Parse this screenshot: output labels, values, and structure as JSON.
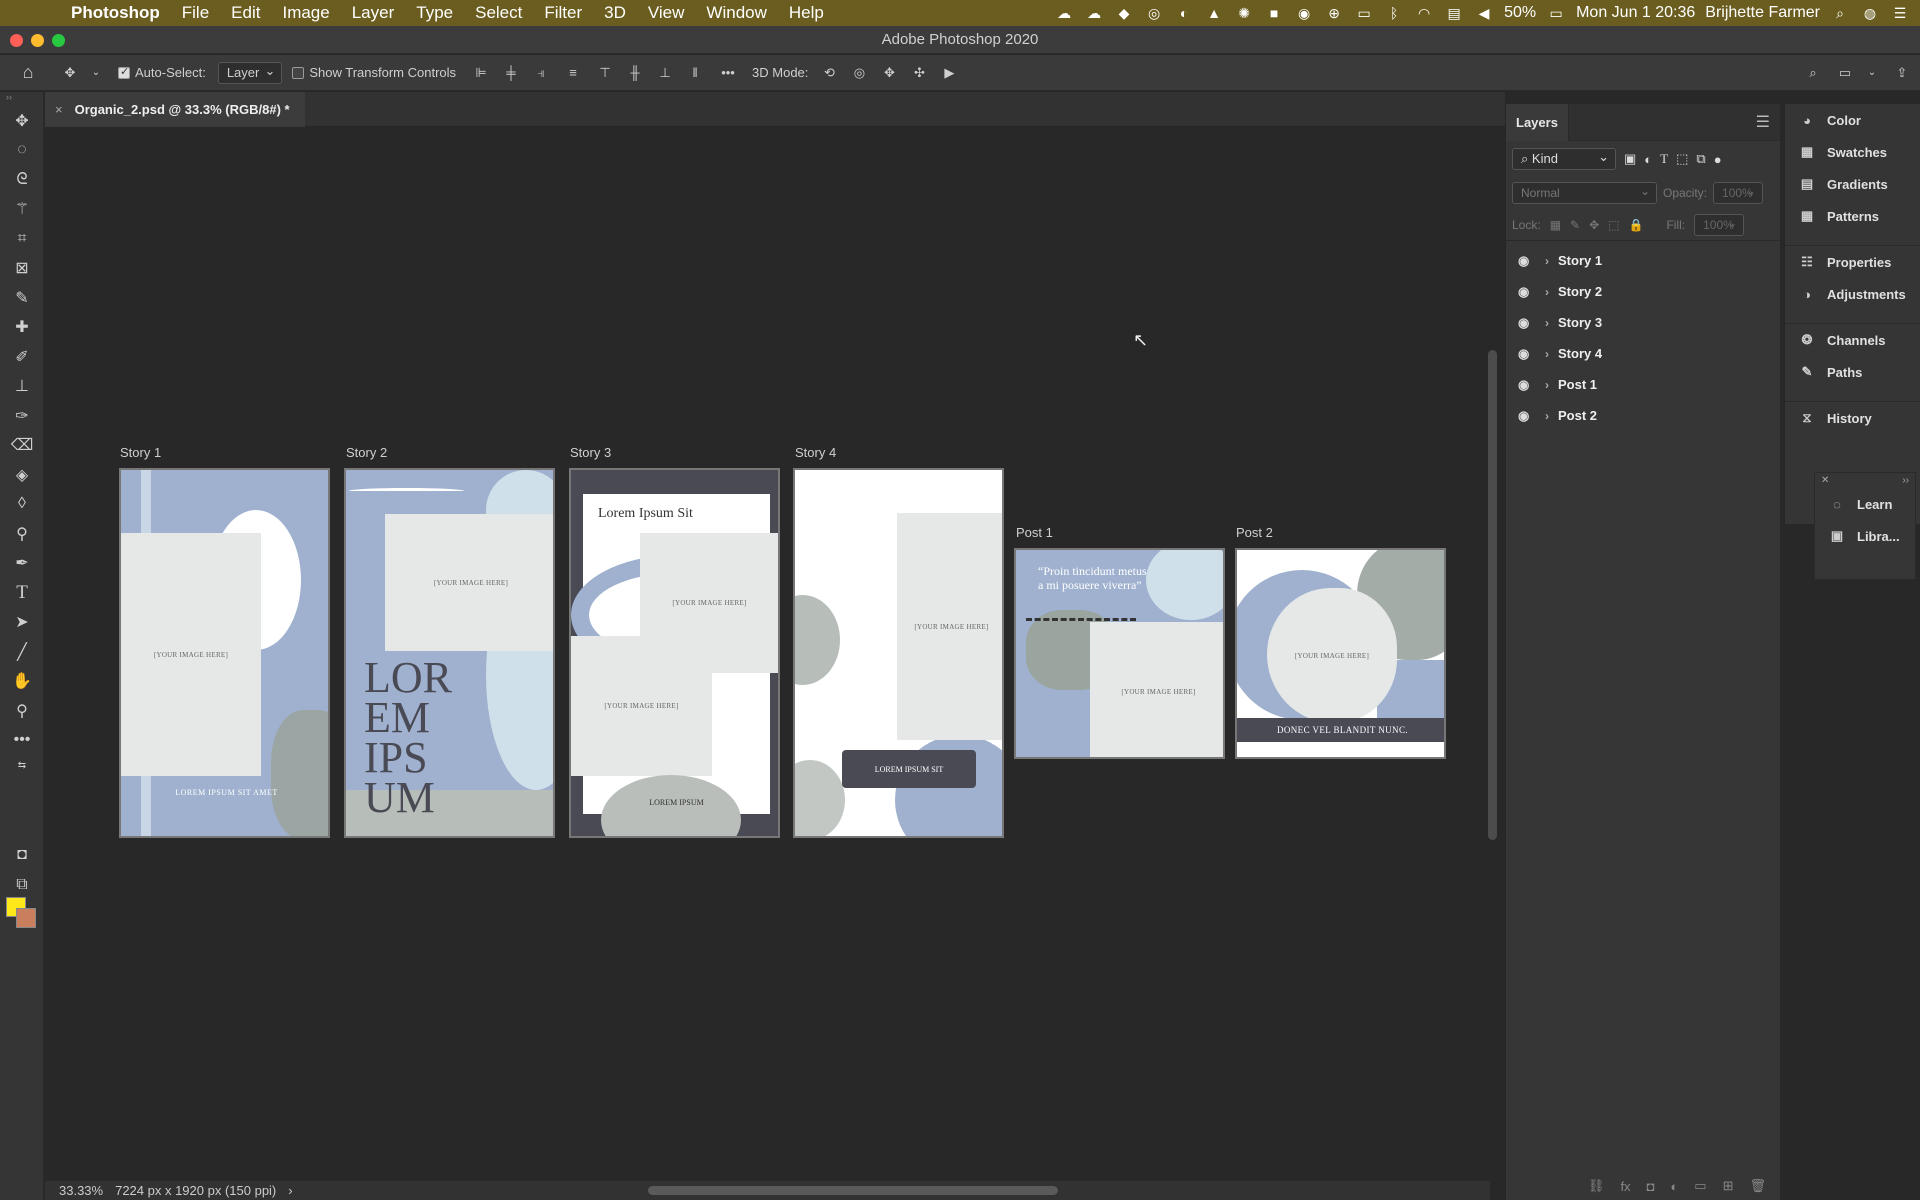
{
  "menubar": {
    "app": "Photoshop",
    "items": [
      "File",
      "Edit",
      "Image",
      "Layer",
      "Type",
      "Select",
      "Filter",
      "3D",
      "View",
      "Window",
      "Help"
    ],
    "battery": "50%",
    "datetime": "Mon Jun 1  20:36",
    "user": "Brijhette Farmer"
  },
  "window": {
    "title": "Adobe Photoshop 2020"
  },
  "options": {
    "auto_select_label": "Auto-Select:",
    "auto_select_value": "Layer",
    "show_transform_label": "Show Transform Controls",
    "mode3d_label": "3D Mode:"
  },
  "document": {
    "tab_title": "Organic_2.psd @ 33.3% (RGB/8#) *",
    "zoom": "33.33%",
    "size_info": "7224 px x 1920 px (150 ppi)"
  },
  "artboards": {
    "story1": {
      "label": "Story 1",
      "ph": "[YOUR IMAGE HERE]",
      "caption": "LOREM IPSUM SIT AMET"
    },
    "story2": {
      "label": "Story 2",
      "ph": "[YOUR IMAGE HERE]",
      "big1": "LOR",
      "big2": "EM",
      "big3": "IPS",
      "big4": "UM"
    },
    "story3": {
      "label": "Story 3",
      "title": "Lorem Ipsum Sit",
      "ph1": "[YOUR IMAGE HERE]",
      "ph2": "[YOUR IMAGE HERE]",
      "caption": "LOREM IPSUM"
    },
    "story4": {
      "label": "Story 4",
      "ph": "[YOUR IMAGE HERE]",
      "caption": "LOREM IPSUM SIT"
    },
    "post1": {
      "label": "Post 1",
      "quote": "“Proin tincidunt metus a mi posuere viverra”",
      "ph": "[YOUR IMAGE HERE]"
    },
    "post2": {
      "label": "Post 2",
      "ph": "[YOUR IMAGE HERE]",
      "caption": "DONEC VEL BLANDIT NUNC."
    }
  },
  "layers_panel": {
    "tab": "Layers",
    "filter": "Kind",
    "blend": "Normal",
    "opacity_label": "Opacity:",
    "opacity_value": "100%",
    "lock_label": "Lock:",
    "fill_label": "Fill:",
    "fill_value": "100%",
    "layers": [
      "Story 1",
      "Story 2",
      "Story 3",
      "Story 4",
      "Post 1",
      "Post 2"
    ]
  },
  "dock": {
    "group1": [
      "Color",
      "Swatches",
      "Gradients",
      "Patterns"
    ],
    "group2": [
      "Properties",
      "Adjustments"
    ],
    "group3": [
      "Channels",
      "Paths"
    ],
    "group4": [
      "History"
    ],
    "learn": "Learn",
    "libraries": "Libra..."
  },
  "colors": {
    "foreground": "#ffe81a",
    "background": "#c97f5d",
    "accent_blue": "#9fb1cf"
  }
}
